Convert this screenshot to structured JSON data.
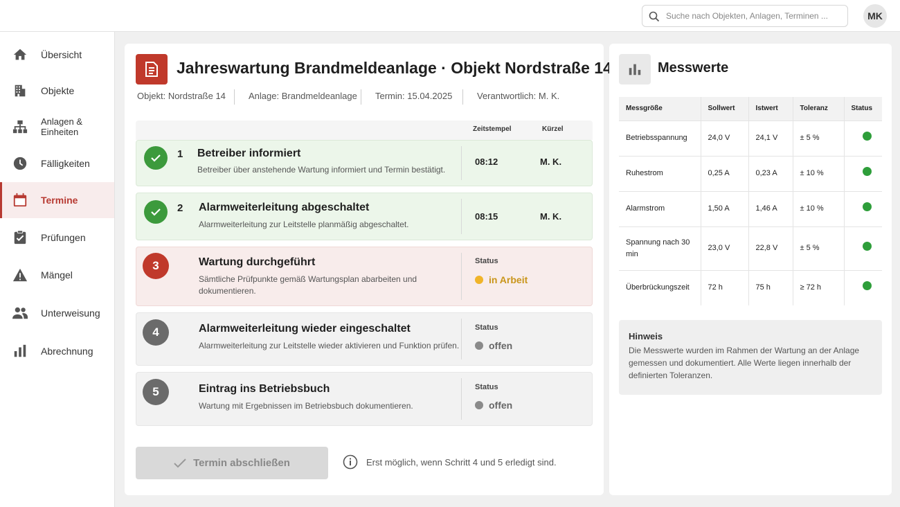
{
  "topbar": {
    "search_placeholder": "Suche nach Objekten, Anlagen, Terminen ...",
    "avatar_initials": "MK"
  },
  "sidebar": {
    "items": [
      {
        "label": "Übersicht",
        "icon": "home-icon",
        "active": false
      },
      {
        "label": "Objekte",
        "icon": "building-icon",
        "active": false
      },
      {
        "label": "Anlagen & Einheiten",
        "icon": "hierarchy-icon",
        "active": false
      },
      {
        "label": "Fälligkeiten",
        "icon": "clock-icon",
        "active": false
      },
      {
        "label": "Termine",
        "icon": "calendar-icon",
        "active": true
      },
      {
        "label": "Prüfungen",
        "icon": "clipboard-check-icon",
        "active": false
      },
      {
        "label": "Mängel",
        "icon": "warning-icon",
        "active": false
      },
      {
        "label": "Unterweisung",
        "icon": "people-icon",
        "active": false
      },
      {
        "label": "Abrechnung",
        "icon": "bar-chart-icon",
        "active": false
      }
    ]
  },
  "header": {
    "title": "Jahreswartung Brandmeldeanlage · Objekt Nordstraße 14",
    "meta": [
      {
        "label": "Objekt:",
        "value": "Nordstraße 14"
      },
      {
        "label": "Anlage:",
        "value": "Brandmeldeanlage"
      },
      {
        "label": "Termin:",
        "value": "15.04.2025"
      },
      {
        "label": "Verantwortlich:",
        "value": "M. K."
      }
    ]
  },
  "steps_table": {
    "col_time": "Zeitstempel",
    "col_initials": "Kürzel"
  },
  "steps": [
    {
      "number": "1",
      "title": "Betreiber informiert",
      "description": "Betreiber über anstehende Wartung informiert und Termin bestätigt.",
      "state": "done",
      "time": "08:12",
      "initials": "M. K."
    },
    {
      "number": "2",
      "title": "Alarmweiterleitung abgeschaltet",
      "description": "Alarmweiterleitung zur Leitstelle planmäßig abgeschaltet.",
      "state": "done",
      "time": "08:15",
      "initials": "M. K."
    },
    {
      "number": "3",
      "title": "Wartung durchgeführt",
      "description": "Sämtliche Prüfpunkte gemäß Wartungsplan abarbeiten und dokumentieren.",
      "state": "active",
      "status_label": "Status",
      "status_value": "in Arbeit"
    },
    {
      "number": "4",
      "title": "Alarmweiterleitung wieder eingeschaltet",
      "description": "Alarmweiterleitung zur Leitstelle wieder aktivieren und Funktion prüfen.",
      "state": "open",
      "status_label": "Status",
      "status_value": "offen"
    },
    {
      "number": "5",
      "title": "Eintrag ins Betriebsbuch",
      "description": "Wartung mit Ergebnissen im Betriebsbuch dokumentieren.",
      "state": "open",
      "status_label": "Status",
      "status_value": "offen"
    }
  ],
  "footer": {
    "finish_button": "Termin abschließen",
    "finish_hint": "Erst möglich, wenn Schritt 4 und 5 erledigt sind."
  },
  "messwerte": {
    "title": "Messwerte",
    "columns": [
      "Messgröße",
      "Sollwert",
      "Istwert",
      "Toleranz",
      "Status"
    ],
    "rows": [
      {
        "name": "Betriebsspannung",
        "soll": "24,0 V",
        "ist": "24,1 V",
        "tol": "± 5 %",
        "status": "ok"
      },
      {
        "name": "Ruhestrom",
        "soll": "0,25 A",
        "ist": "0,23 A",
        "tol": "± 10 %",
        "status": "ok"
      },
      {
        "name": "Alarmstrom",
        "soll": "1,50 A",
        "ist": "1,46 A",
        "tol": "± 10 %",
        "status": "ok"
      },
      {
        "name": "Spannung nach 30 min",
        "soll": "23,0 V",
        "ist": "22,8 V",
        "tol": "± 5 %",
        "status": "ok"
      },
      {
        "name": "Überbrückungszeit",
        "soll": "72 h",
        "ist": "75 h",
        "tol": "≥ 72 h",
        "status": "ok"
      }
    ],
    "hint_title": "Hinweis",
    "hint_text": "Die Messwerte wurden im Rahmen der Wartung an der Anlage gemessen und dokumentiert. Alle Werte liegen innerhalb der definierten Toleranzen."
  },
  "colors": {
    "accent": "#c0392b",
    "done": "#3c9a3c",
    "in_progress": "#f0b429",
    "open": "#8a8a8a",
    "status_ok": "#2e9e3a"
  }
}
